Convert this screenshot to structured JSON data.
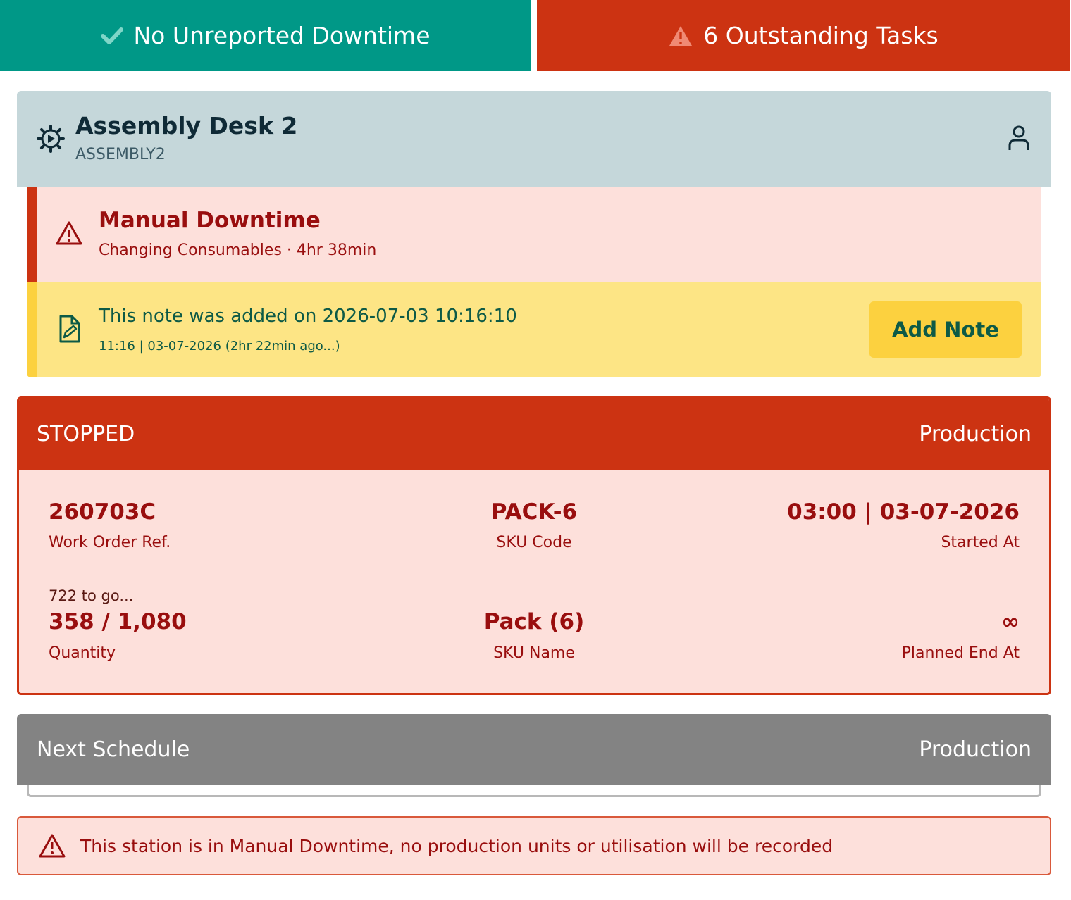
{
  "banners": {
    "downtime": {
      "text": "No Unreported Downtime",
      "icon": "check-icon",
      "color": "#009887"
    },
    "tasks": {
      "text": "6 Outstanding Tasks",
      "icon": "warning-triangle-icon",
      "color": "#cc3312"
    }
  },
  "station": {
    "name": "Assembly Desk 2",
    "code": "ASSEMBLY2",
    "icon": "gear-play-icon",
    "user_icon": "user-icon"
  },
  "downtime": {
    "title": "Manual Downtime",
    "subtitle": "Changing Consumables · 4hr 38min",
    "icon": "warning-triangle-icon"
  },
  "note": {
    "text": "This note was added on 2026-07-03 10:16:10",
    "meta": "11:16 | 03-07-2026 (2hr 22min ago...)",
    "button_label": "Add Note",
    "icon": "edit-document-icon"
  },
  "current_order": {
    "status": "STOPPED",
    "type": "Production",
    "work_order_ref": {
      "value": "260703C",
      "label": "Work Order Ref."
    },
    "sku_code": {
      "value": "PACK-6",
      "label": "SKU Code"
    },
    "started_at": {
      "value": "03:00 | 03-07-2026",
      "label": "Started At"
    },
    "quantity": {
      "remaining": "722 to go...",
      "value": "358 / 1,080",
      "label": "Quantity"
    },
    "sku_name": {
      "value": "Pack (6)",
      "label": "SKU Name"
    },
    "planned_end": {
      "value": "∞",
      "label": "Planned End At"
    }
  },
  "next_schedule": {
    "title": "Next Schedule",
    "type": "Production"
  },
  "alert": {
    "text": "This station is in Manual Downtime, no production units or utilisation will be recorded",
    "icon": "warning-triangle-icon"
  }
}
